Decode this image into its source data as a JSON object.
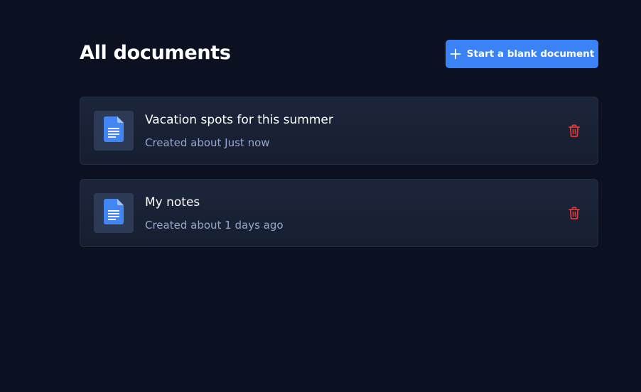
{
  "header": {
    "title": "All documents",
    "new_button_label": "Start a blank document",
    "new_button_icon": "plus-icon"
  },
  "documents": [
    {
      "title": "Vacation spots for this summer",
      "meta": "Created about Just now",
      "icon": "google-docs-icon",
      "action_icon": "trash-icon"
    },
    {
      "title": "My notes",
      "meta": "Created about 1 days ago",
      "icon": "google-docs-icon",
      "action_icon": "trash-icon"
    }
  ],
  "colors": {
    "background": "#0b1120",
    "accent": "#3b82f6",
    "card": "#1a2336",
    "danger": "#dc3c3c",
    "meta_text": "#93a8d0"
  }
}
